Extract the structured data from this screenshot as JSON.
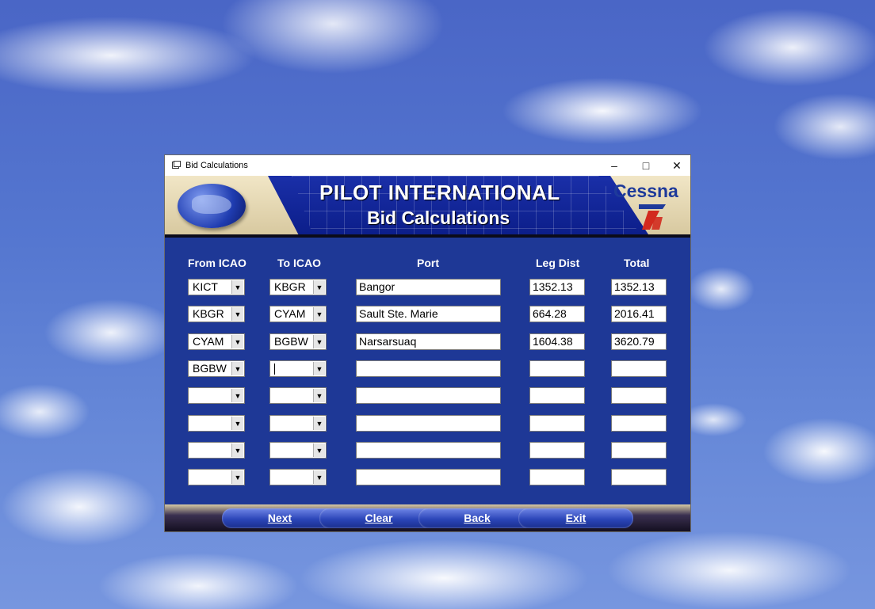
{
  "window": {
    "title": "Bid Calculations"
  },
  "banner": {
    "title": "PILOT INTERNATIONAL",
    "subtitle": "Bid Calculations",
    "brand": "Cessna"
  },
  "headers": {
    "from": "From ICAO",
    "to": "To ICAO",
    "port": "Port",
    "leg": "Leg Dist",
    "total": "Total"
  },
  "rows": [
    {
      "from": "KICT",
      "to": "KBGR",
      "port": "Bangor",
      "leg": "1352.13",
      "total": "1352.13"
    },
    {
      "from": "KBGR",
      "to": "CYAM",
      "port": "Sault Ste. Marie",
      "leg": "664.28",
      "total": "2016.41"
    },
    {
      "from": "CYAM",
      "to": "BGBW",
      "port": "Narsarsuaq",
      "leg": "1604.38",
      "total": "3620.79"
    },
    {
      "from": "BGBW",
      "to": "",
      "port": "",
      "leg": "",
      "total": ""
    },
    {
      "from": "",
      "to": "",
      "port": "",
      "leg": "",
      "total": ""
    },
    {
      "from": "",
      "to": "",
      "port": "",
      "leg": "",
      "total": ""
    },
    {
      "from": "",
      "to": "",
      "port": "",
      "leg": "",
      "total": ""
    },
    {
      "from": "",
      "to": "",
      "port": "",
      "leg": "",
      "total": ""
    }
  ],
  "buttons": {
    "next": "Next",
    "clear": "Clear",
    "back": "Back",
    "exit": "Exit"
  }
}
